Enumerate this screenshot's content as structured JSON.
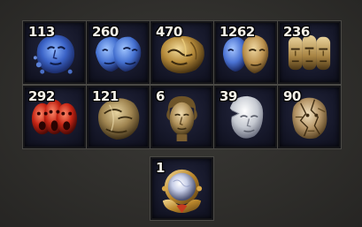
{
  "stash": {
    "items": [
      {
        "id": "item-1",
        "icon": "blue-fractured-face-fragment-icon",
        "count": "113"
      },
      {
        "id": "item-2",
        "icon": "blue-twin-faces-fragment-icon",
        "count": "260"
      },
      {
        "id": "item-3",
        "icon": "gold-masked-faces-fragment-icon",
        "count": "470"
      },
      {
        "id": "item-4",
        "icon": "blue-gold-twin-faces-fragment-icon",
        "count": "1262"
      },
      {
        "id": "item-5",
        "icon": "gold-triple-faces-fragment-icon",
        "count": "236"
      },
      {
        "id": "item-6",
        "icon": "red-screaming-faces-fragment-icon",
        "count": "292"
      },
      {
        "id": "item-7",
        "icon": "bronze-layered-faces-fragment-icon",
        "count": "121"
      },
      {
        "id": "item-8",
        "icon": "bronze-woman-head-fragment-icon",
        "count": "6"
      },
      {
        "id": "item-9",
        "icon": "marble-broken-head-fragment-icon",
        "count": "39"
      },
      {
        "id": "item-10",
        "icon": "cracked-stone-face-fragment-icon",
        "count": "90"
      },
      {
        "id": "item-11",
        "icon": "crystal-orb-amulet-icon",
        "count": "1"
      }
    ]
  }
}
